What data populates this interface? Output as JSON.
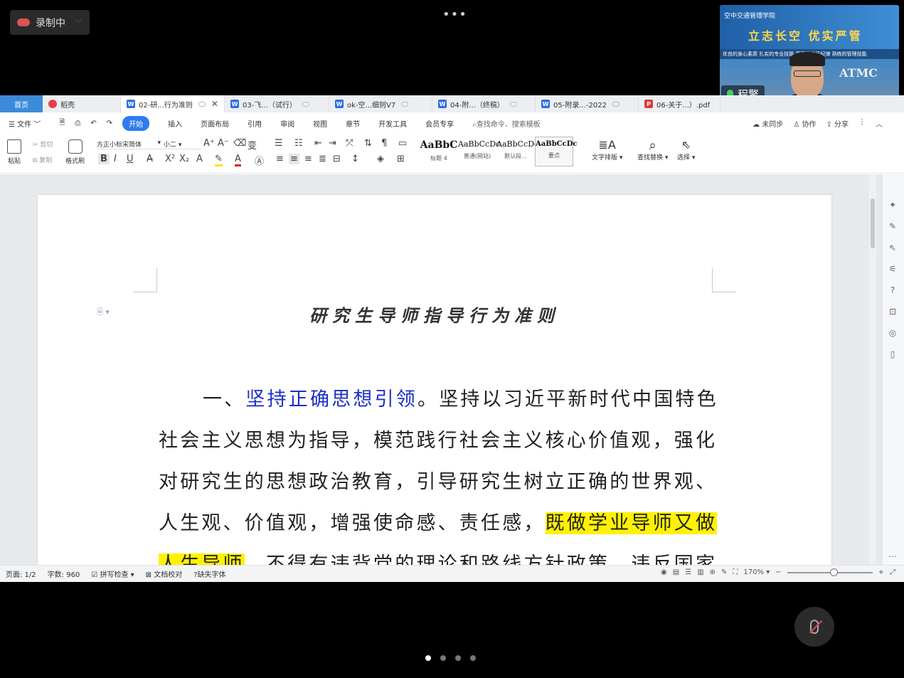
{
  "recording": {
    "label": "录制中"
  },
  "top_menu": {
    "dots": "•••"
  },
  "video": {
    "college": "空中交通管理学院",
    "slogan": "立志长空  优实严管",
    "slogan_sub": "优良的身心素质  扎实的专业技能  严明的作风纪律  熟练的管理技能",
    "badge": "ATMC",
    "speaker_name": "程擎"
  },
  "tabs": [
    {
      "label": "首页",
      "type": "home"
    },
    {
      "label": "稻壳",
      "type": "docer"
    },
    {
      "label": "02-研...行为准则",
      "type": "word",
      "active": true
    },
    {
      "label": "03-飞...（试行）",
      "type": "word"
    },
    {
      "label": "ok-空...细则V7",
      "type": "word"
    },
    {
      "label": "04-附...（终稿）",
      "type": "word"
    },
    {
      "label": "05-附录...-2022",
      "type": "word"
    },
    {
      "label": "06-关于...）.pdf",
      "type": "pdf"
    }
  ],
  "menu": {
    "file": "文件",
    "start": "开始",
    "items": [
      "插入",
      "页面布局",
      "引用",
      "审阅",
      "视图",
      "章节",
      "开发工具",
      "会员专享"
    ],
    "search": "查找命令、搜索模板",
    "unsynced": "未同步",
    "collab": "协作",
    "share": "分享"
  },
  "ribbon": {
    "paste": "粘贴",
    "cut": "剪切",
    "copy": "复制",
    "format_painter": "格式刷",
    "font_name": "方正小标宋简体",
    "font_size": "小二",
    "styles": [
      {
        "sample": "AaBbC",
        "name": "标题 4"
      },
      {
        "sample": "AaBbCcDc",
        "name": "普通(网站)"
      },
      {
        "sample": "AaBbCcDd",
        "name": "默认段..."
      },
      {
        "sample": "AaBbCcDc",
        "name": "要点",
        "selected": true
      }
    ],
    "text_layout": "文字排版",
    "find_replace": "查找替换",
    "select": "选择"
  },
  "document": {
    "title": "研究生导师指导行为准则",
    "para": {
      "lead": "一、",
      "heading": "坚持正确思想引领",
      "l1_rest": "。坚持以习近平新时代中国特色",
      "l2": "社会主义思想为指导，模范践行社会主义核心价值观，强化",
      "l3": "对研究生的思想政治教育，引导研究生树立正确的世界观、",
      "l4_a": "人生观、价值观，增强使命感、责任感，",
      "l4_hl": "既做学业导师又做",
      "l5_hl": "人生导师",
      "l5_rest": "。不得有违背党的理论和路线方针政策、违反国家"
    }
  },
  "status": {
    "page": "页面: 1/2",
    "words": "字数: 960",
    "spell": "拼写检查",
    "proof": "文档校对",
    "missing_font": "缺失字体",
    "zoom": "170%"
  },
  "colors": {
    "heading_blue": "#1c2fc4",
    "highlight": "#fff200",
    "start_button": "#2f7bf0",
    "home_tab": "#3c8bd9"
  }
}
